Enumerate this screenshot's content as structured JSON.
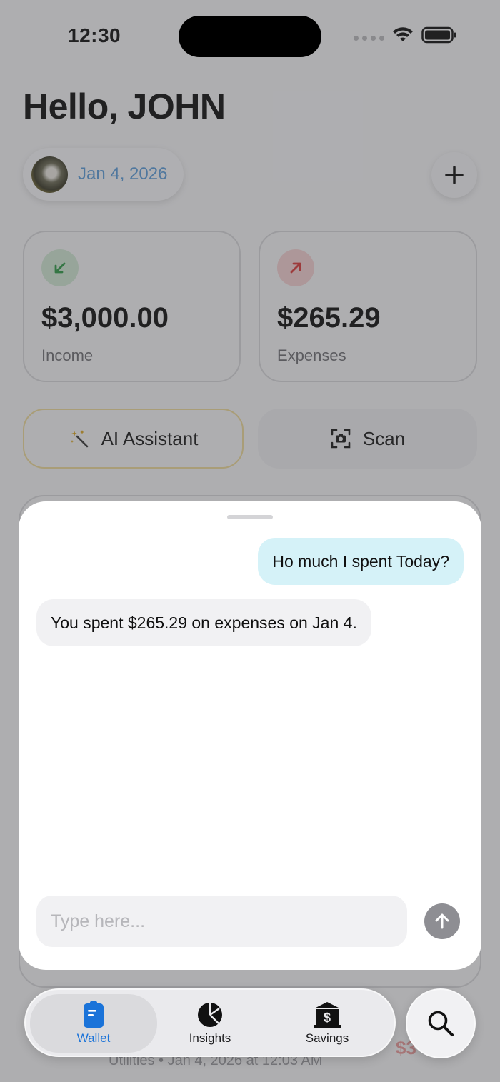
{
  "status_bar": {
    "time": "12:30"
  },
  "header": {
    "greeting": "Hello, JOHN",
    "date": "Jan 4, 2026"
  },
  "summary": {
    "income": {
      "amount": "$3,000.00",
      "label": "Income"
    },
    "expenses": {
      "amount": "$265.29",
      "label": "Expenses"
    }
  },
  "actions": {
    "ai_assistant": "AI Assistant",
    "scan": "Scan"
  },
  "chat": {
    "user_message": "Ho much I spent Today?",
    "assistant_message": "You spent $265.29 on expenses on Jan 4.",
    "input_placeholder": "Type here...",
    "input_value": ""
  },
  "background_list": {
    "row_subtitle": "Utilities • Jan 4, 2026 at 12:03 AM",
    "row_amount": "$3"
  },
  "tabbar": {
    "tabs": [
      {
        "label": "Wallet",
        "icon": "wallet-icon",
        "active": true
      },
      {
        "label": "Insights",
        "icon": "pie-chart-icon",
        "active": false
      },
      {
        "label": "Savings",
        "icon": "bank-icon",
        "active": false
      }
    ],
    "search_icon": "search-icon"
  },
  "colors": {
    "accent_blue": "#1a73d9",
    "date_blue": "#5b9bd8",
    "income_green": "#2f9a47",
    "expense_red": "#d93b3b",
    "ai_gold": "#d8a21a",
    "user_bubble": "#d5f2f8",
    "send_button": "#8e8e93"
  }
}
